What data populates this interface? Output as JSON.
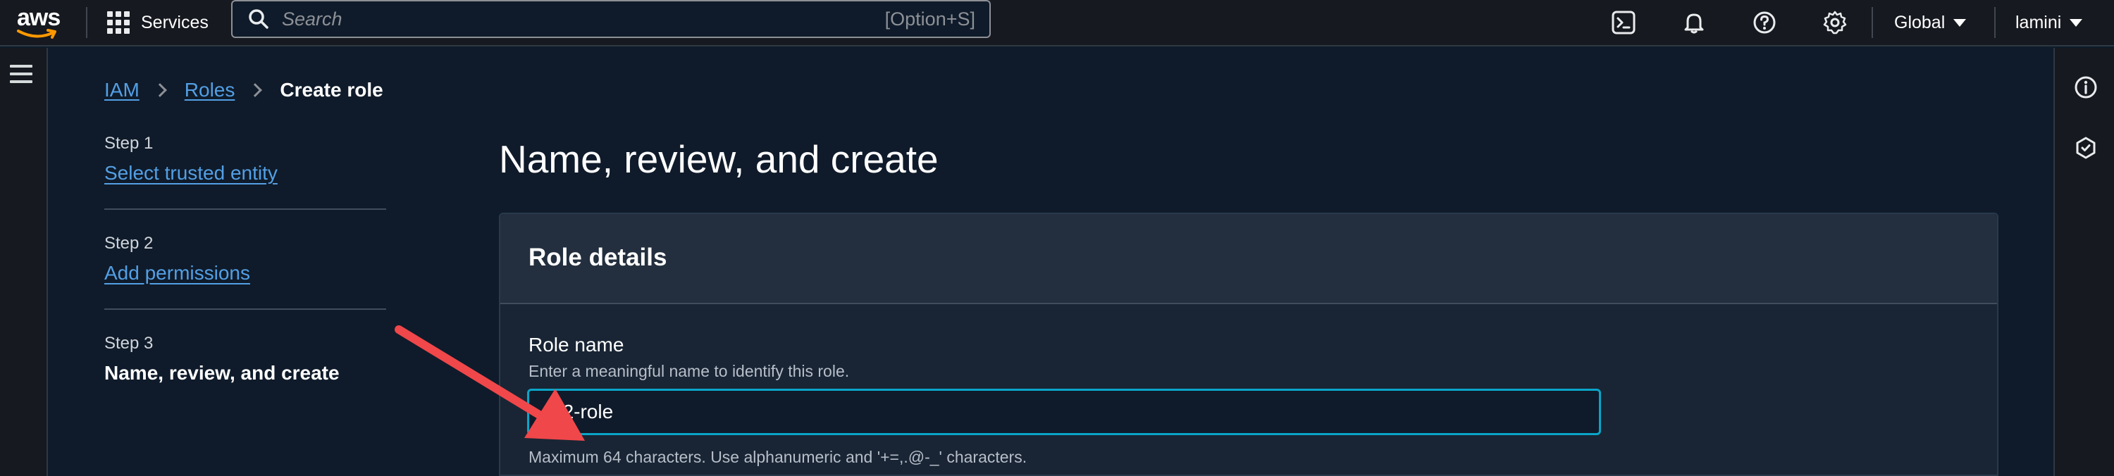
{
  "topnav": {
    "logo_text": "aws",
    "services_label": "Services",
    "search_placeholder": "Search",
    "search_shortcut": "[Option+S]",
    "icons": [
      "cloudshell-icon",
      "notifications-icon",
      "help-icon",
      "settings-icon"
    ],
    "region_label": "Global",
    "user_label": "lamini"
  },
  "breadcrumb": {
    "items": [
      {
        "label": "IAM"
      },
      {
        "label": "Roles"
      }
    ],
    "current": "Create role"
  },
  "steps": [
    {
      "number": "Step 1",
      "label": "Select trusted entity",
      "state": "link"
    },
    {
      "number": "Step 2",
      "label": "Add permissions",
      "state": "link"
    },
    {
      "number": "Step 3",
      "label": "Name, review, and create",
      "state": "current"
    }
  ],
  "page": {
    "title": "Name, review, and create"
  },
  "role_details": {
    "title": "Role details",
    "role_name_label": "Role name",
    "role_name_description": "Enter a meaningful name to identify this role.",
    "role_name_value": "ec2-role",
    "role_name_hint": "Maximum 64 characters. Use alphanumeric and '+=,.@-_' characters."
  },
  "right_rail": {
    "icons": [
      "info-icon",
      "feedback-icon"
    ]
  },
  "colors": {
    "link": "#539fe5",
    "focus_border": "#0aa5c9",
    "annotation_arrow": "#f0474a"
  }
}
